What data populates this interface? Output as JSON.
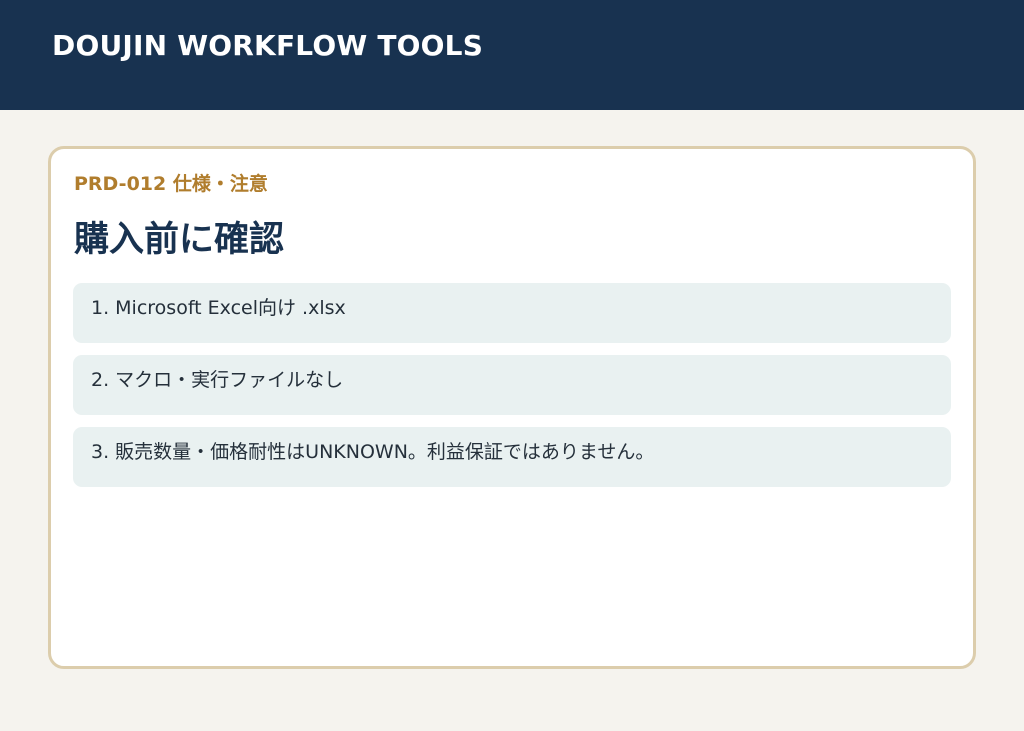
{
  "header": {
    "title": "DOUJIN WORKFLOW TOOLS"
  },
  "card": {
    "kicker": "PRD-012  仕様・注意",
    "title": "購入前に確認",
    "items": [
      {
        "text": "1. Microsoft Excel向け .xlsx"
      },
      {
        "text": "2. マクロ・実行ファイルなし"
      },
      {
        "text": "3. 販売数量・価格耐性はUNKNOWN。利益保証ではありません。"
      }
    ]
  },
  "colors": {
    "header_bg": "#183250",
    "page_bg": "#f5f3ee",
    "card_border": "#dccdac",
    "accent": "#b07d2d",
    "title_text": "#183250",
    "item_bg": "#e9f1f1"
  }
}
